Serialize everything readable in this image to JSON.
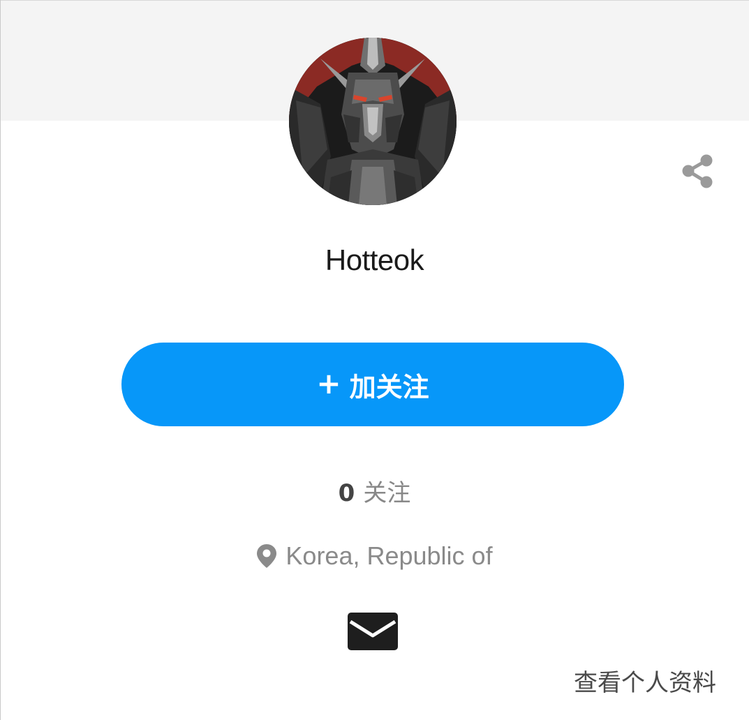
{
  "profile": {
    "username": "Hotteok",
    "avatar_icon": "robot-avatar-image",
    "location": "Korea, Republic of"
  },
  "actions": {
    "share_icon": "share-icon",
    "follow_plus": "+",
    "follow_label": "加关注",
    "mail_icon": "mail-icon",
    "view_profile_label": "查看个人资料"
  },
  "stats": {
    "following_count": "0",
    "following_label": "关注"
  },
  "colors": {
    "accent": "#0797f9",
    "banner": "#f4f4f4",
    "muted_text": "#8a8a8a"
  }
}
